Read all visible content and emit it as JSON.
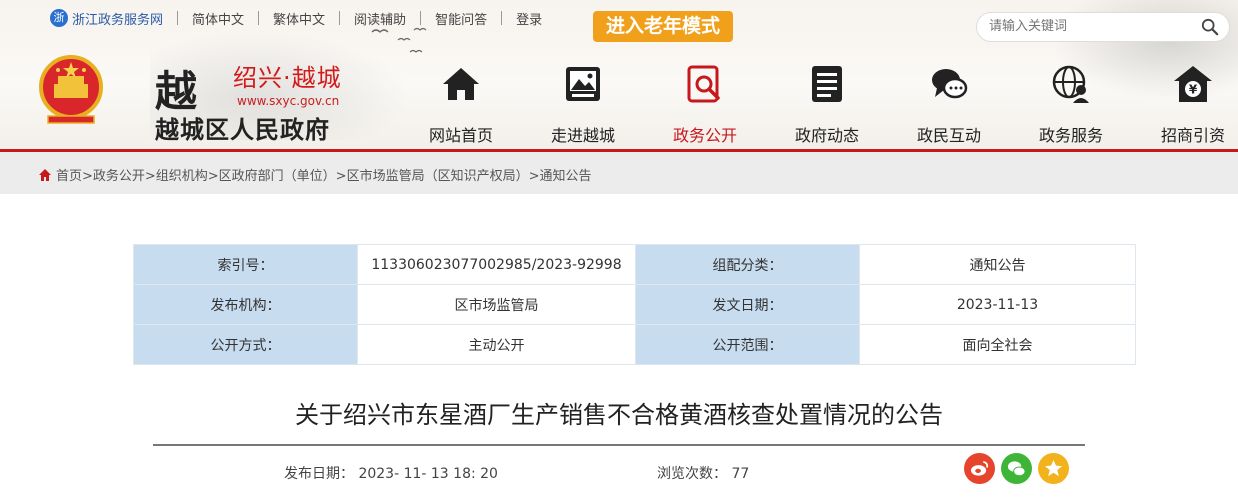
{
  "topbar": {
    "portal": "浙江政务服务网",
    "links": [
      "简体中文",
      "繁体中文",
      "阅读辅助",
      "智能问答",
      "登录"
    ],
    "elder_mode": "进入老年模式"
  },
  "search": {
    "placeholder": "请输入关键词"
  },
  "site": {
    "char": "越",
    "city": "绍兴·越城",
    "url": "www.sxyc.gov.cn",
    "name": "越城区人民政府"
  },
  "nav": [
    {
      "label": "网站首页",
      "icon": "home-icon"
    },
    {
      "label": "走进越城",
      "icon": "picture-icon"
    },
    {
      "label": "政务公开",
      "icon": "document-search-icon",
      "active": true
    },
    {
      "label": "政府动态",
      "icon": "news-icon"
    },
    {
      "label": "政民互动",
      "icon": "chat-icon"
    },
    {
      "label": "政务服务",
      "icon": "globe-user-icon"
    },
    {
      "label": "招商引资",
      "icon": "yen-house-icon"
    }
  ],
  "breadcrumb": "首页>政务公开>组织机构>区政府部门（单位）>区市场监管局（区知识产权局）>通知公告",
  "meta": {
    "index_label": "索引号：",
    "index_value": "113306023077002985/2023-92998",
    "category_label": "组配分类：",
    "category_value": "通知公告",
    "org_label": "发布机构：",
    "org_value": "区市场监管局",
    "date_label": "发文日期：",
    "date_value": "2023-11-13",
    "mode_label": "公开方式：",
    "mode_value": "主动公开",
    "scope_label": "公开范围：",
    "scope_value": "面向全社会"
  },
  "article": {
    "title": "关于绍兴市东星酒厂生产销售不合格黄酒核查处置情况的公告",
    "pub_date": "发布日期： 2023- 11- 13 18: 20",
    "views": "浏览次数： 77"
  },
  "colors": {
    "accent": "#c7181d",
    "elder": "#f0a01a",
    "table_key_bg": "#c8dcef"
  }
}
